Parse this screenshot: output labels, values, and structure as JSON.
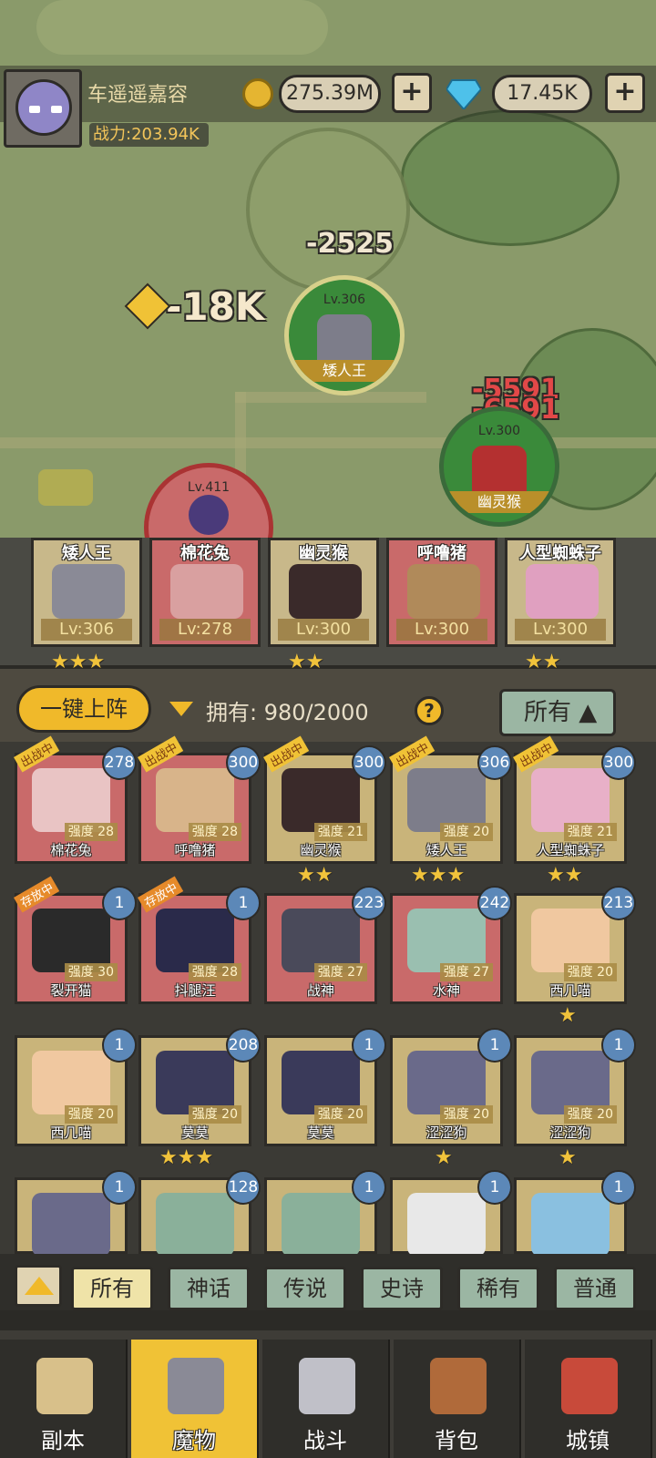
{
  "player": {
    "name": "车遥遥嘉容",
    "power_label": "战力:203.94K"
  },
  "currency": {
    "gold": "275.39M",
    "gems": "17.45K",
    "plus": "+"
  },
  "battle": {
    "damage_texts": [
      "-2525",
      "-18K",
      "-5591",
      "-6591"
    ],
    "units": [
      {
        "level": "Lv.306",
        "name": "矮人王"
      },
      {
        "level": "Lv.300",
        "name": "幽灵猴"
      },
      {
        "level": "Lv.411",
        "name": ""
      }
    ]
  },
  "team": [
    {
      "name": "矮人王",
      "level": "Lv:306",
      "stars": "★★★",
      "color": "#c8b88a"
    },
    {
      "name": "棉花兔",
      "level": "Lv:278",
      "stars": "",
      "color": "#c96a6a"
    },
    {
      "name": "幽灵猴",
      "level": "Lv:300",
      "stars": "★★",
      "color": "#c8b88a"
    },
    {
      "name": "呼噜猪",
      "level": "Lv:300",
      "stars": "",
      "color": "#c96a6a"
    },
    {
      "name": "人型蜘蛛子",
      "level": "Lv:300",
      "stars": "★★",
      "color": "#c8b88a"
    }
  ],
  "controls": {
    "one_key": "一键上阵",
    "owned": "拥有: 980/2000",
    "help": "?",
    "filter_all": "所有 ▲"
  },
  "cards": [
    {
      "name": "棉花兔",
      "lv": "278",
      "str": "强度 28",
      "tag": "出战中",
      "stars": ""
    },
    {
      "name": "呼噜猪",
      "lv": "300",
      "str": "强度 28",
      "tag": "出战中",
      "stars": ""
    },
    {
      "name": "幽灵猴",
      "lv": "300",
      "str": "强度 21",
      "tag": "出战中",
      "stars": "★★"
    },
    {
      "name": "矮人王",
      "lv": "306",
      "str": "强度 20",
      "tag": "出战中",
      "stars": "★★★"
    },
    {
      "name": "人型蜘蛛子",
      "lv": "300",
      "str": "强度 21",
      "tag": "出战中",
      "stars": "★★"
    },
    {
      "name": "裂开猫",
      "lv": "1",
      "str": "强度 30",
      "tag": "存放中",
      "stars": ""
    },
    {
      "name": "抖腿汪",
      "lv": "1",
      "str": "强度 28",
      "tag": "存放中",
      "stars": ""
    },
    {
      "name": "战神",
      "lv": "223",
      "str": "强度 27",
      "tag": "",
      "stars": ""
    },
    {
      "name": "水神",
      "lv": "242",
      "str": "强度 27",
      "tag": "",
      "stars": ""
    },
    {
      "name": "西几喵",
      "lv": "213",
      "str": "强度 20",
      "tag": "",
      "stars": "★"
    },
    {
      "name": "西几喵",
      "lv": "1",
      "str": "强度 20",
      "tag": "",
      "stars": ""
    },
    {
      "name": "莫莫",
      "lv": "208",
      "str": "强度 20",
      "tag": "",
      "stars": "★★★"
    },
    {
      "name": "莫莫",
      "lv": "1",
      "str": "强度 20",
      "tag": "",
      "stars": ""
    },
    {
      "name": "涩涩狗",
      "lv": "1",
      "str": "强度 20",
      "tag": "",
      "stars": "★"
    },
    {
      "name": "涩涩狗",
      "lv": "1",
      "str": "强度 20",
      "tag": "",
      "stars": "★"
    },
    {
      "name": "",
      "lv": "1",
      "str": "",
      "tag": "",
      "stars": ""
    },
    {
      "name": "",
      "lv": "128",
      "str": "",
      "tag": "",
      "stars": ""
    },
    {
      "name": "",
      "lv": "1",
      "str": "",
      "tag": "",
      "stars": ""
    },
    {
      "name": "",
      "lv": "1",
      "str": "",
      "tag": "",
      "stars": ""
    },
    {
      "name": "",
      "lv": "1",
      "str": "",
      "tag": "",
      "stars": ""
    }
  ],
  "filters": [
    "所有",
    "神话",
    "传说",
    "史诗",
    "稀有",
    "普通"
  ],
  "nav": [
    "副本",
    "魔物",
    "战斗",
    "背包",
    "城镇"
  ]
}
